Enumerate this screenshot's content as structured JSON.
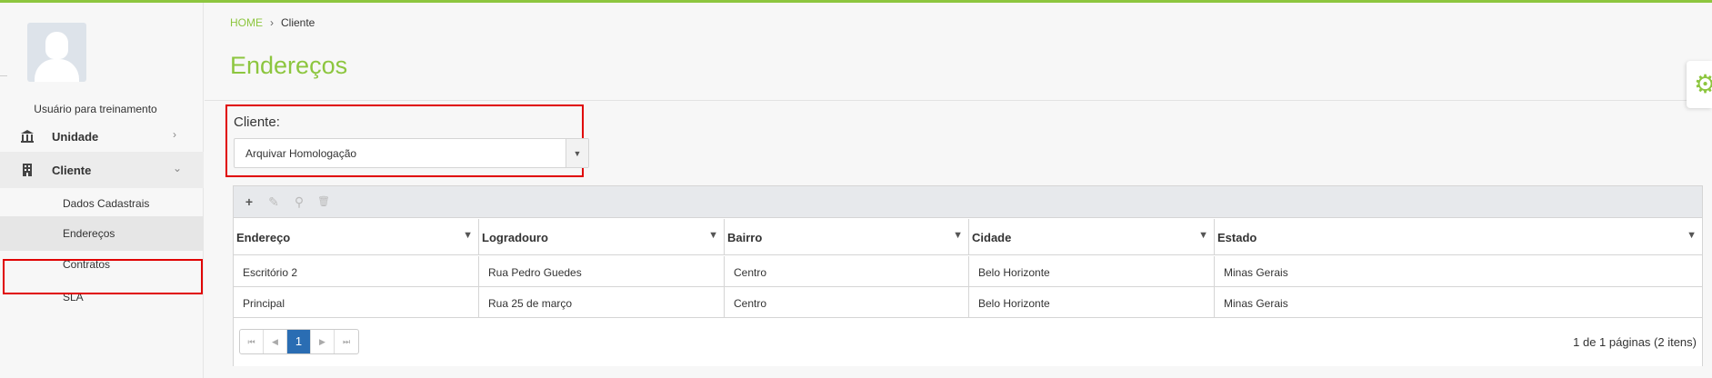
{
  "user": {
    "name": "Usuário para treinamento"
  },
  "nav": {
    "unidade": {
      "label": "Unidade",
      "icon": "bank-icon",
      "chevron": "›"
    },
    "cliente": {
      "label": "Cliente",
      "icon": "building-icon",
      "chevron": "⌄"
    },
    "submenu": [
      {
        "label": "Dados Cadastrais"
      },
      {
        "label": "Endereços"
      },
      {
        "label": "Contratos"
      },
      {
        "label": "SLA"
      }
    ]
  },
  "breadcrumb": {
    "home": "HOME",
    "separator": "›",
    "current": "Cliente"
  },
  "page": {
    "title": "Endereços"
  },
  "client": {
    "label": "Cliente:",
    "value": "Arquivar Homologação",
    "arrow": "▼"
  },
  "toolbar": {
    "add": "+",
    "edit": "✎",
    "search": "⚲",
    "delete": "🗑"
  },
  "grid": {
    "columns": [
      "Endereço",
      "Logradouro",
      "Bairro",
      "Cidade",
      "Estado"
    ],
    "filter_icon": "▼",
    "rows": [
      [
        "Escritório 2",
        "Rua Pedro Guedes",
        "Centro",
        "Belo Horizonte",
        "Minas Gerais"
      ],
      [
        "Principal",
        "Rua 25 de março",
        "Centro",
        "Belo Horizonte",
        "Minas Gerais"
      ]
    ]
  },
  "pager": {
    "first": "⏮",
    "prev": "◀",
    "current": "1",
    "next": "▶",
    "last": "⏭",
    "info": "1 de 1 páginas (2 itens)"
  },
  "colors": {
    "accent": "#8dc63f",
    "highlight": "#e00000",
    "pager_active": "#2a6db3"
  }
}
